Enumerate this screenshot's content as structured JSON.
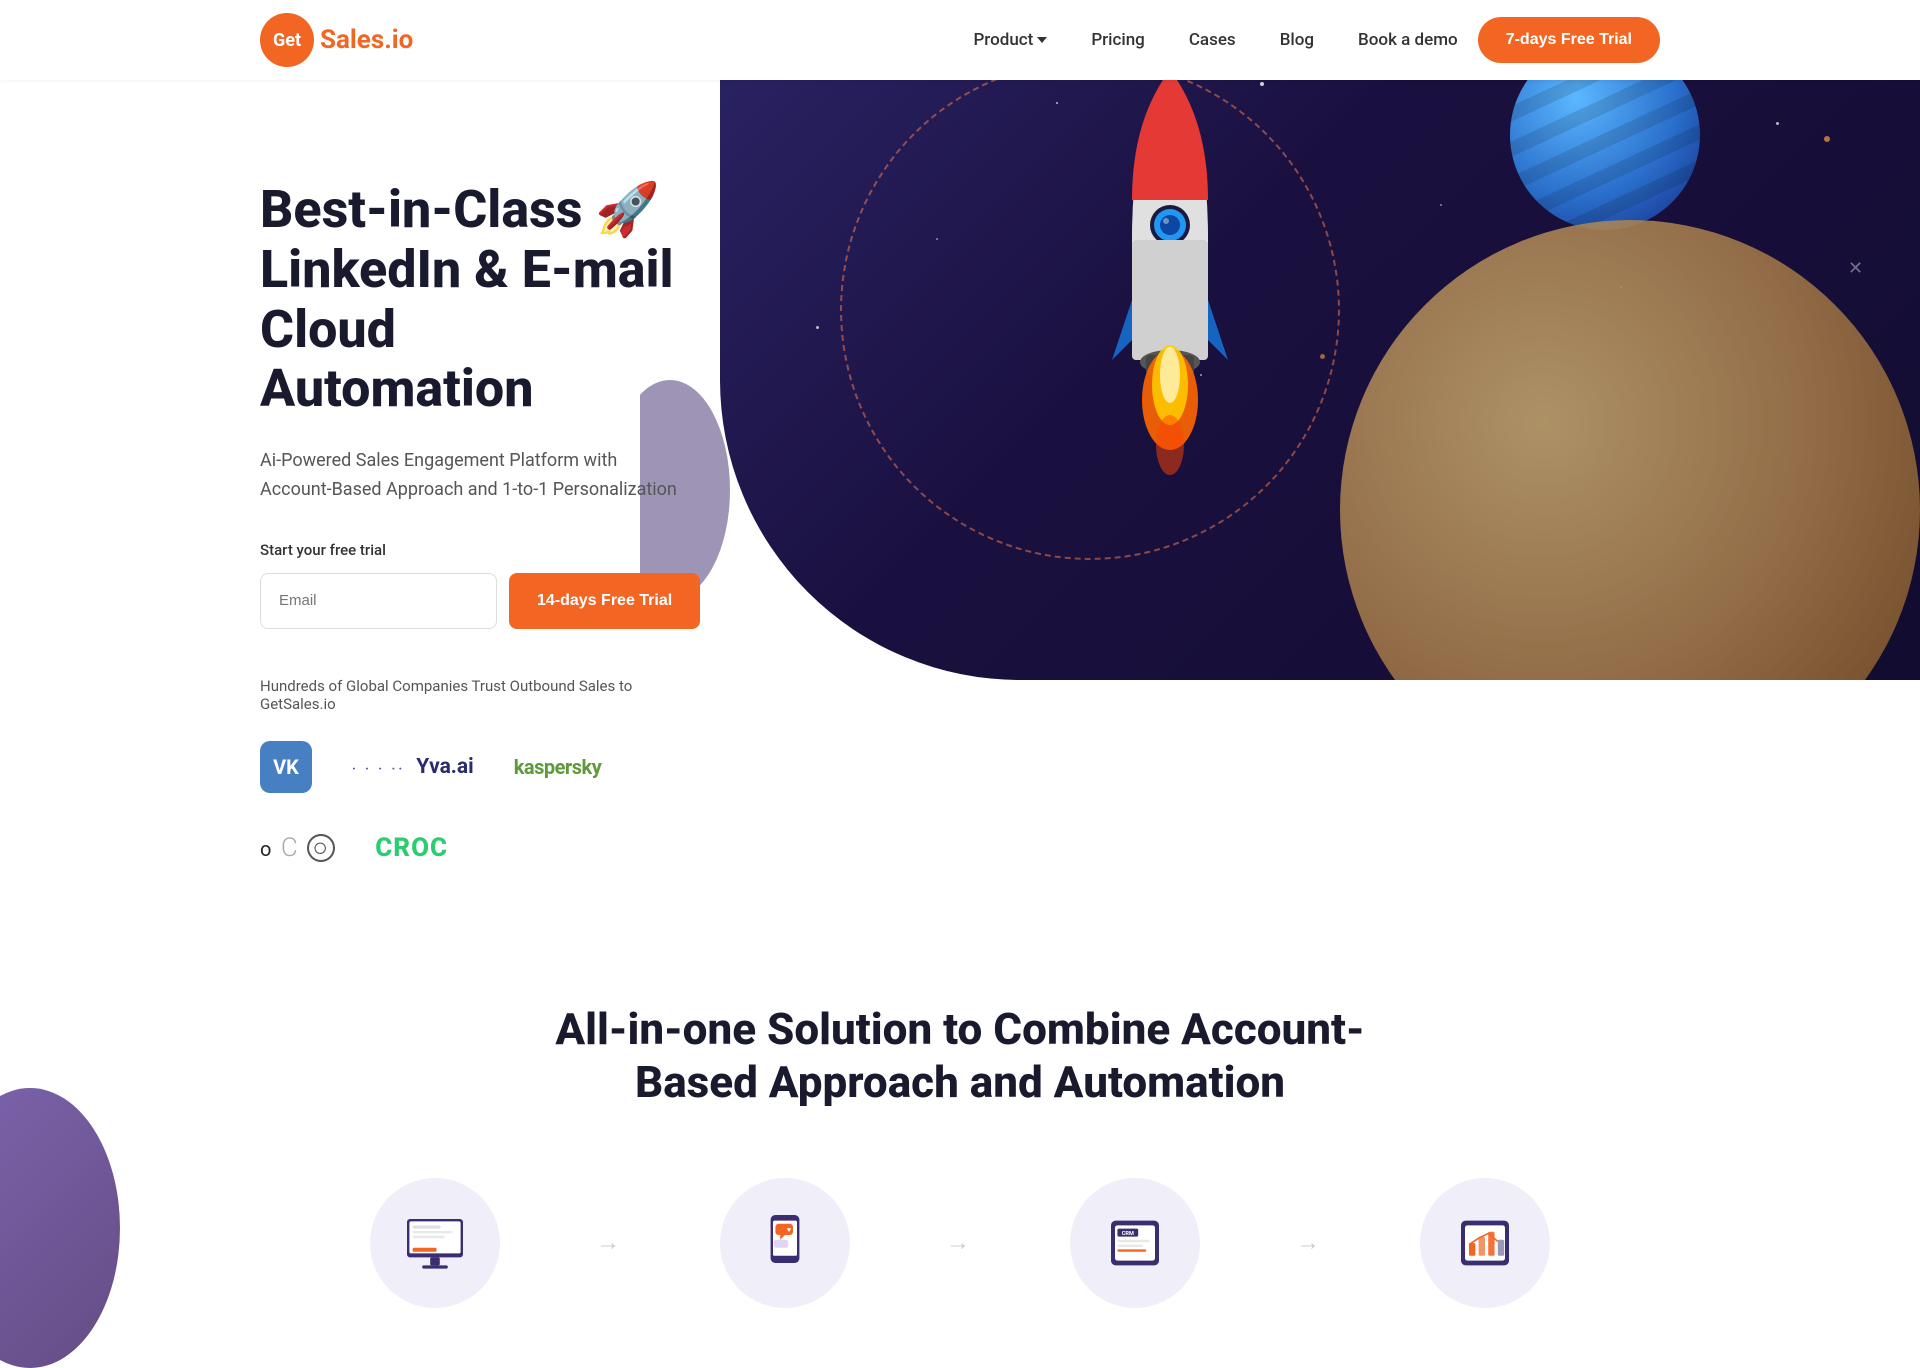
{
  "nav": {
    "logo_get": "Get",
    "logo_sales": "Sales.io",
    "links": [
      {
        "label": "Product",
        "has_dropdown": true,
        "id": "product"
      },
      {
        "label": "Pricing",
        "has_dropdown": false,
        "id": "pricing"
      },
      {
        "label": "Cases",
        "has_dropdown": false,
        "id": "cases"
      },
      {
        "label": "Blog",
        "has_dropdown": false,
        "id": "blog"
      },
      {
        "label": "Book a demo",
        "has_dropdown": false,
        "id": "book-demo"
      }
    ],
    "cta_label": "7-days Free Trial"
  },
  "hero": {
    "title_line1": "Best-in-Class 🚀",
    "title_line2": "LinkedIn & E-mail",
    "title_line3": "Cloud Automation",
    "subtitle": "Ai-Powered Sales Engagement Platform with Account-Based Approach and 1-to-1 Personalization",
    "free_trial_label": "Start your free trial",
    "email_placeholder": "Email",
    "cta_14day": "14-days Free Trial",
    "trust_text": "Hundreds of Global Companies Trust Outbound Sales to GetSales.io",
    "logos": [
      {
        "id": "vk",
        "label": "VK",
        "type": "vk"
      },
      {
        "id": "yva",
        "label": "Yva.ai",
        "type": "text"
      },
      {
        "id": "kaspersky",
        "label": "kaspersky",
        "type": "text"
      },
      {
        "id": "oco",
        "label": "oCO",
        "type": "text"
      },
      {
        "id": "croc",
        "label": "CROC",
        "type": "text"
      }
    ]
  },
  "lower": {
    "title_line1": "All-in-one Solution to Combine Account-",
    "title_line2": "Based Approach and Automation",
    "features": [
      {
        "id": "feature1",
        "icon": "📄"
      },
      {
        "id": "feature2",
        "icon": "💬"
      },
      {
        "id": "feature3",
        "icon": "🗄️"
      },
      {
        "id": "feature4",
        "icon": "📊"
      }
    ]
  },
  "colors": {
    "orange": "#F26522",
    "dark_navy": "#1a1a2e",
    "space_dark": "#1a1040",
    "green": "#2ecc71"
  }
}
